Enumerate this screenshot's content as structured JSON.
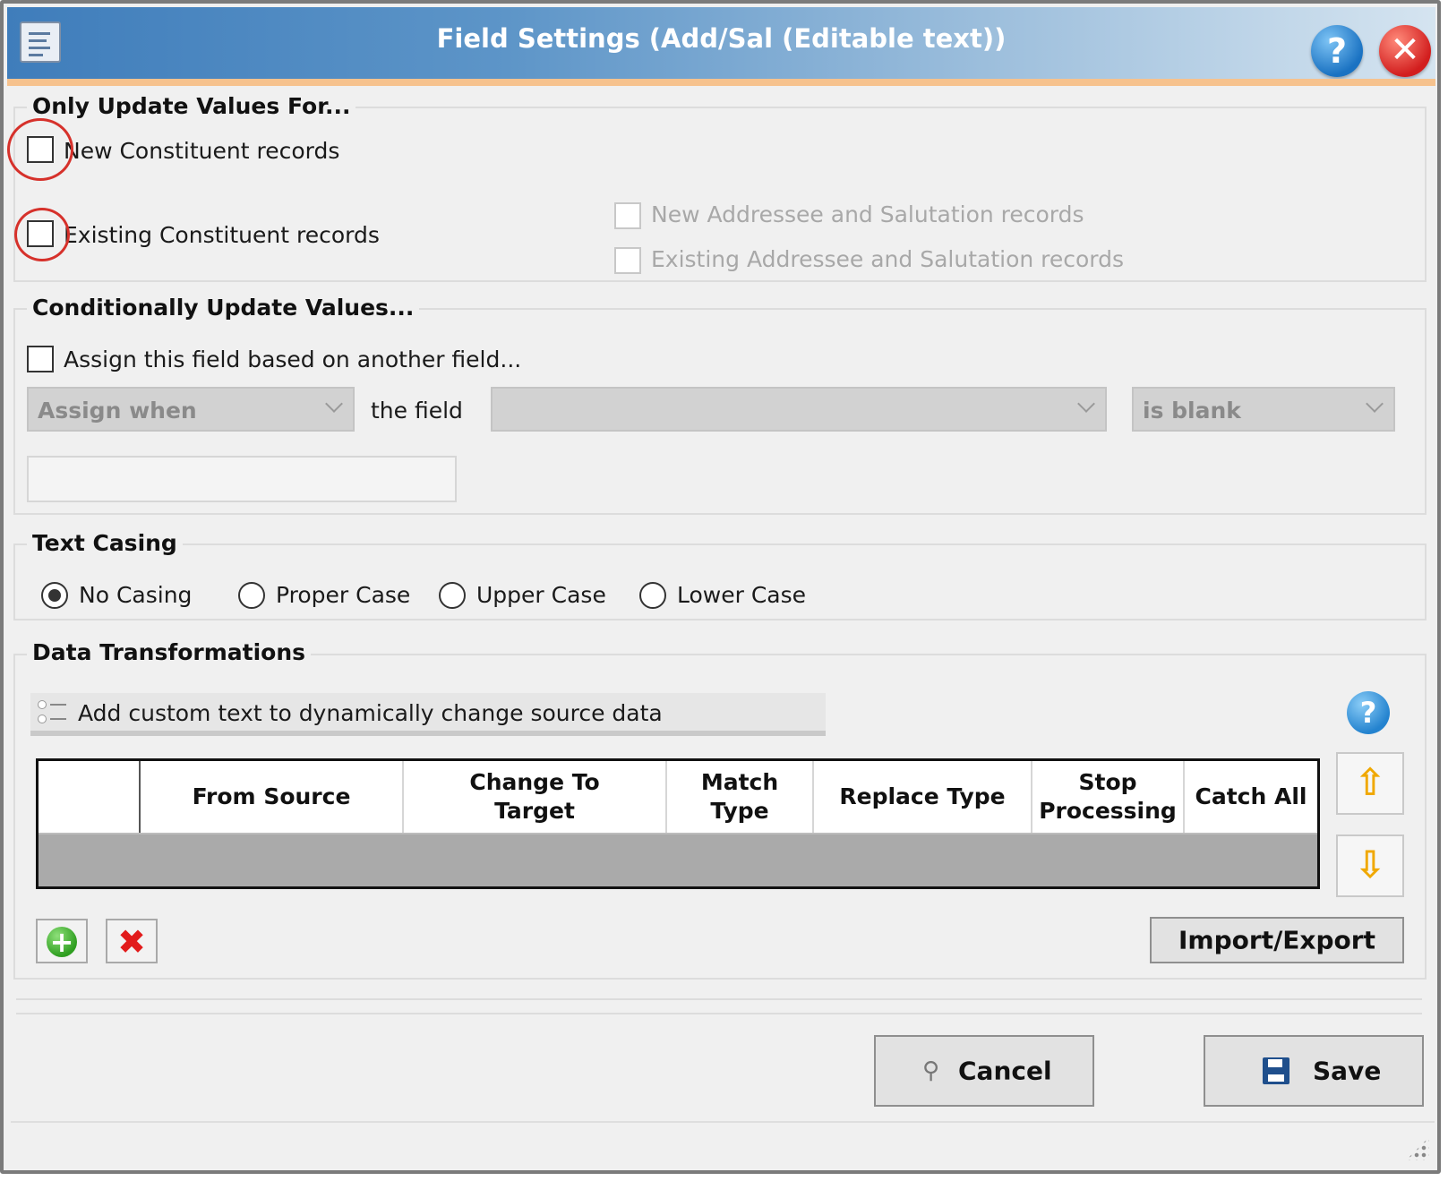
{
  "window": {
    "title": "Field Settings (Add/Sal (Editable text))",
    "help_symbol": "?",
    "close_symbol": "✕"
  },
  "only_update": {
    "legend": "Only Update Values For...",
    "new_constituent": "New Constituent records",
    "existing_constituent": "Existing Constituent records",
    "new_addressee": "New Addressee and Salutation records",
    "existing_addressee": "Existing Addressee and Salutation records"
  },
  "conditional": {
    "legend": "Conditionally Update Values...",
    "assign_checkbox": "Assign this field based on another field...",
    "assign_when": "Assign when",
    "the_field": "the field",
    "field_value": "",
    "condition": "is blank",
    "value_text": ""
  },
  "text_casing": {
    "legend": "Text Casing",
    "options": [
      "No Casing",
      "Proper Case",
      "Upper Case",
      "Lower Case"
    ],
    "selected": "No Casing"
  },
  "data_transformations": {
    "legend": "Data Transformations",
    "toolbar_text": "Add custom text to dynamically change source data",
    "help_symbol": "?",
    "columns": [
      "",
      "From Source",
      "Change To Target",
      "Match Type",
      "Replace Type",
      "Stop Processing",
      "Catch All"
    ],
    "rows": [],
    "move_up_symbol": "⇧",
    "move_down_symbol": "⇩",
    "add_symbol": "+",
    "remove_symbol": "✖",
    "import_export": "Import/Export"
  },
  "footer": {
    "cancel": "Cancel",
    "save": "Save"
  },
  "colors": {
    "title_gradient_start": "#3f7dbb",
    "accent_orange": "#f6c28e",
    "annotation_red": "#d6312b",
    "disabled_gray": "#a8a8a8"
  }
}
